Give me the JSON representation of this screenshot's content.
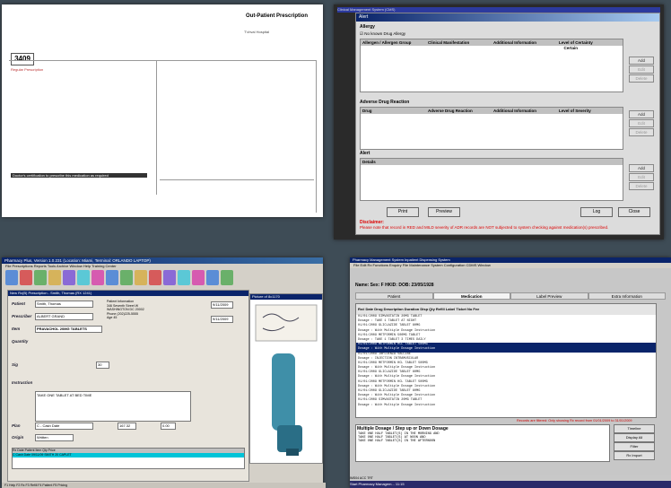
{
  "panel1": {
    "logo_text": "Out-Patient Prescription",
    "hospital": "T'chval Hospital",
    "box_number": "3409",
    "section_label": "Regular Prescription",
    "black_bar_text": "Doctor's certification to prescribe this medication as required"
  },
  "panel2": {
    "title_bar": "Clinical Management System (CMS)",
    "window_title": "Alert",
    "allergy_label": "Allergy",
    "no_known_label": "No known Drug Allergy",
    "allergy_headers": [
      "Allergen / Allergen Group",
      "Clinical Manifestation",
      "Additional Information",
      "Level of Certainty"
    ],
    "certainty_value": "Certain",
    "adr_label": "Adverse Drug Reaction",
    "adr_headers": [
      "Drug",
      "Adverse Drug Reaction",
      "Additional Information",
      "Level of Severity"
    ],
    "alert_label": "Alert",
    "alert_headers": [
      "Details"
    ],
    "btn_add": "Add",
    "btn_edit": "Edit",
    "btn_delete": "Delete",
    "btn_print": "Print",
    "btn_preview": "Preview",
    "btn_log": "Log",
    "btn_close": "Close",
    "disclaimer_title": "Disclaimer:",
    "disclaimer_text": "Please note that record in RED and MILD severity of ADR records are NOT subjected to system checking against medication(s) prescribed."
  },
  "panel3": {
    "title": "Pharmacy Plus, Version 1.0.231 (Location: Miami, Terminal: ORLANDO LAPTOP)",
    "menu": "File  Prescriptions  Reports  Tools  Archive  Window  Help  Training Center",
    "form_title": "New Rx(B) Prescription - Smith, Thomas (RX 1241)",
    "labels": {
      "patient": "Patient",
      "prescriber": "Prescriber",
      "item": "Item",
      "quantity": "Quantity",
      "sig": "Sig",
      "instruction": "Instruction",
      "plan": "Plan",
      "origin": "Origin"
    },
    "patient_value": "Smith, Thomas",
    "prescriber_value": "ALBERT GRAND",
    "item_value": "PRAVACHOL 20MG TABLETS",
    "patient_info": "Patient Information\n346 Seventh Street W\nWASHINGTON DC 20002\nPhone (202)225-5555\nAge 45",
    "written": "9/11/2009",
    "dispensed": "9/11/2009",
    "instruction_value": "TAKE ONE TABLET AT BED TIME",
    "plan_value": "C - Cash Date",
    "price": "167.32",
    "copay": "0.00",
    "origin_value": "Written",
    "days": "30",
    "table_header": "Rx   Date   Patient   Item   Qty   Price",
    "table_row": "C Cash Date   09/11/09   SMITH   20 CAPLET",
    "picture_title": "Picture of 8c1170",
    "status": "F1 Help  F2 Rx  F3 Refill  F4 Patient  F5 Pricing"
  },
  "panel4": {
    "title": "Pharmacy Management System Inpatient Dispensing System",
    "menu": "File  Edit  Rx Functions  Enquiry  File Maintenance  System Configuration  CDMS  Window",
    "patient_line": "Name:          Sex:  F    HKID:          DOB: 23/05/1928",
    "tabs": [
      "Patient",
      "Medication",
      "Label Preview",
      "Extra Information"
    ],
    "grid_header": "Rx# Date  Drug Description          Duration  Disp Qty  Refill  Label  Ticket No  Fee",
    "rows": [
      "01/01/2009 SIMVASTATIN 20MG TABLET",
      "  Dosage : TAKE 1 TABLET AT NIGHT",
      "01/01/2009 GLICLAZIDE TABLET 80MG",
      "  Dosage : With Multiple Dosage Instruction",
      "01/01/2009 METFORMIN 500MG TABLET",
      "  Dosage : TAKE 1 TABLET 3 TIMES DAILY",
      "01/01/2009 METFORMIN HCL TABLET 500MG",
      "  Dosage : With Multiple Dosage Instruction",
      "01/01/2009 INFLUENZA VACCINE",
      "  Dosage : INJECTION INTRAMUSCULAR",
      "01/01/2009 METFORMIN HCL TABLET 500MG",
      "  Dosage : With Multiple Dosage Instruction",
      "01/01/2009 GLICLAZIDE TABLET 80MG",
      "  Dosage : With Multiple Dosage Instruction",
      "01/01/2009 METFORMIN HCL TABLET 500MG",
      "  Dosage : With Multiple Dosage Instruction",
      "01/01/2009 GLICLAZIDE TABLET 80MG",
      "  Dosage : With Multiple Dosage Instruction",
      "01/01/2009 SIMVASTATIN 20MG TABLET",
      "  Dosage : With Multiple Dosage Instruction"
    ],
    "selected_row": 6,
    "warning": "Records are filtered: Only showing Rx record from 01/01/2009 to 31/01/2009",
    "md_title": "Multiple Dosage / Step up or Down Dosage",
    "md_lines": [
      "TAKE ONE HALF TABLET(S) IN THE MORNING AND",
      "TAKE ONE HALF TABLET(S) AT NOON AND",
      "TAKE ONE HALF TABLET(S) IN THE AFTERNOON"
    ],
    "buttons": [
      "Timeline",
      "Display All",
      "Filter",
      "Rx Import"
    ],
    "status": "IMS04   ACC   TRT",
    "taskbar": "Start   Pharmacy Managem...   11:15"
  },
  "colors": {
    "bg": "#3e4c56",
    "win_blue": "#0a246a",
    "selected_cyan": "#00c4d8",
    "red_text": "#dd0000"
  }
}
